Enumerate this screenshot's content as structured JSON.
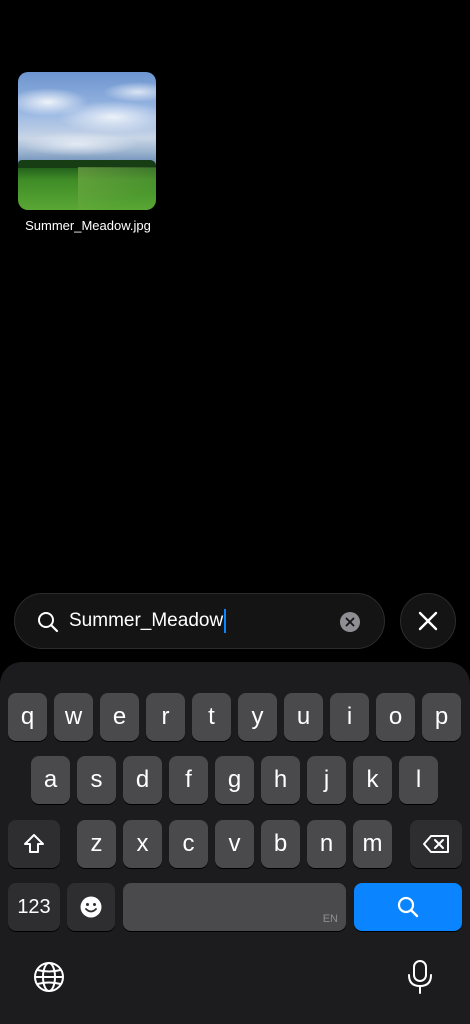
{
  "results": {
    "files": [
      {
        "name": "Summer_Meadow.jpg"
      }
    ]
  },
  "search": {
    "query": "Summer_Meadow"
  },
  "keyboard": {
    "row1": [
      "q",
      "w",
      "e",
      "r",
      "t",
      "y",
      "u",
      "i",
      "o",
      "p"
    ],
    "row2": [
      "a",
      "s",
      "d",
      "f",
      "g",
      "h",
      "j",
      "k",
      "l"
    ],
    "row3": [
      "z",
      "x",
      "c",
      "v",
      "b",
      "n",
      "m"
    ],
    "numbers_label": "123",
    "space_language": "EN",
    "accent_color": "#0a84ff"
  }
}
